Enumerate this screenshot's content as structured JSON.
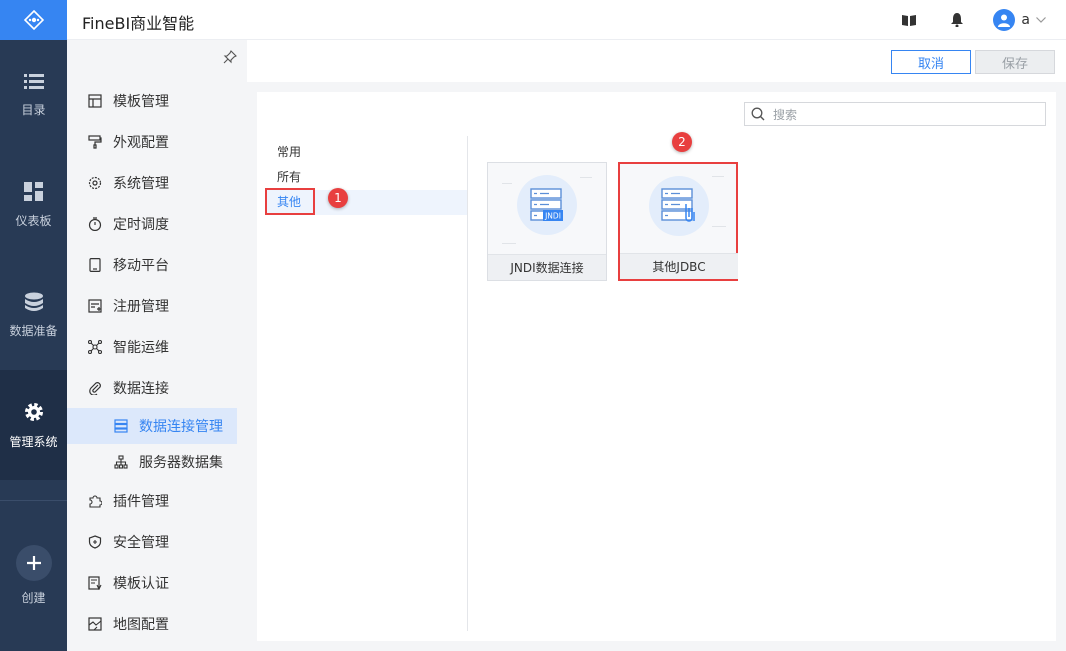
{
  "app": {
    "title": "FineBI商业智能",
    "user": "a"
  },
  "rail": {
    "items": [
      {
        "label": "目录",
        "icon": "list-icon"
      },
      {
        "label": "仪表板",
        "icon": "dashboard-icon"
      },
      {
        "label": "数据准备",
        "icon": "database-icon"
      },
      {
        "label": "管理系统",
        "icon": "gear-icon"
      },
      {
        "label": "创建",
        "icon": "plus-icon"
      }
    ]
  },
  "sidebar": {
    "items": [
      {
        "label": "模板管理"
      },
      {
        "label": "外观配置"
      },
      {
        "label": "系统管理"
      },
      {
        "label": "定时调度"
      },
      {
        "label": "移动平台"
      },
      {
        "label": "注册管理"
      },
      {
        "label": "智能运维"
      },
      {
        "label": "数据连接"
      },
      {
        "label": "数据连接管理"
      },
      {
        "label": "服务器数据集"
      },
      {
        "label": "插件管理"
      },
      {
        "label": "安全管理"
      },
      {
        "label": "模板认证"
      },
      {
        "label": "地图配置"
      }
    ]
  },
  "toolbar": {
    "cancel_label": "取消",
    "save_label": "保存"
  },
  "search": {
    "placeholder": "搜索"
  },
  "categories": [
    {
      "label": "常用"
    },
    {
      "label": "所有"
    },
    {
      "label": "其他"
    }
  ],
  "cards": [
    {
      "label": "JNDI数据连接",
      "art_text": "JNDI"
    },
    {
      "label": "其他JDBC"
    }
  ],
  "annotations": {
    "step1": "1",
    "step2": "2"
  },
  "colors": {
    "accent": "#3685f2",
    "rail_bg": "#283a55",
    "highlight": "#e83f3f"
  }
}
